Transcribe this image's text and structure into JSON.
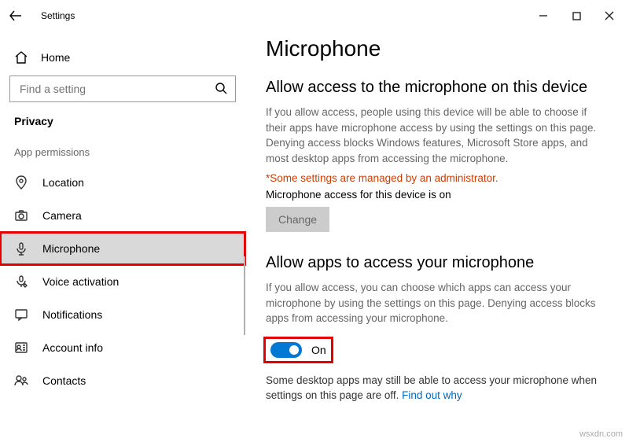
{
  "window": {
    "title": "Settings",
    "controls": {
      "min": "—",
      "max": "☐",
      "close": "✕"
    }
  },
  "sidebar": {
    "home_label": "Home",
    "search_placeholder": "Find a setting",
    "breadcrumb": "Privacy",
    "section_label": "App permissions",
    "items": [
      {
        "label": "Location"
      },
      {
        "label": "Camera"
      },
      {
        "label": "Microphone"
      },
      {
        "label": "Voice activation"
      },
      {
        "label": "Notifications"
      },
      {
        "label": "Account info"
      },
      {
        "label": "Contacts"
      }
    ]
  },
  "main": {
    "title": "Microphone",
    "section1": {
      "heading": "Allow access to the microphone on this device",
      "body": "If you allow access, people using this device will be able to choose if their apps have microphone access by using the settings on this page. Denying access blocks Windows features, Microsoft Store apps, and most desktop apps from accessing the microphone.",
      "admin_warning": "*Some settings are managed by an administrator.",
      "device_status": "Microphone access for this device is on",
      "change_label": "Change"
    },
    "section2": {
      "heading": "Allow apps to access your microphone",
      "body": "If you allow access, you can choose which apps can access your microphone by using the settings on this page. Denying access blocks apps from accessing your microphone.",
      "toggle_label": "On"
    },
    "footer": {
      "text": "Some desktop apps may still be able to access your microphone when settings on this page are off. ",
      "link": "Find out why"
    }
  },
  "watermark": "wsxdn.com"
}
